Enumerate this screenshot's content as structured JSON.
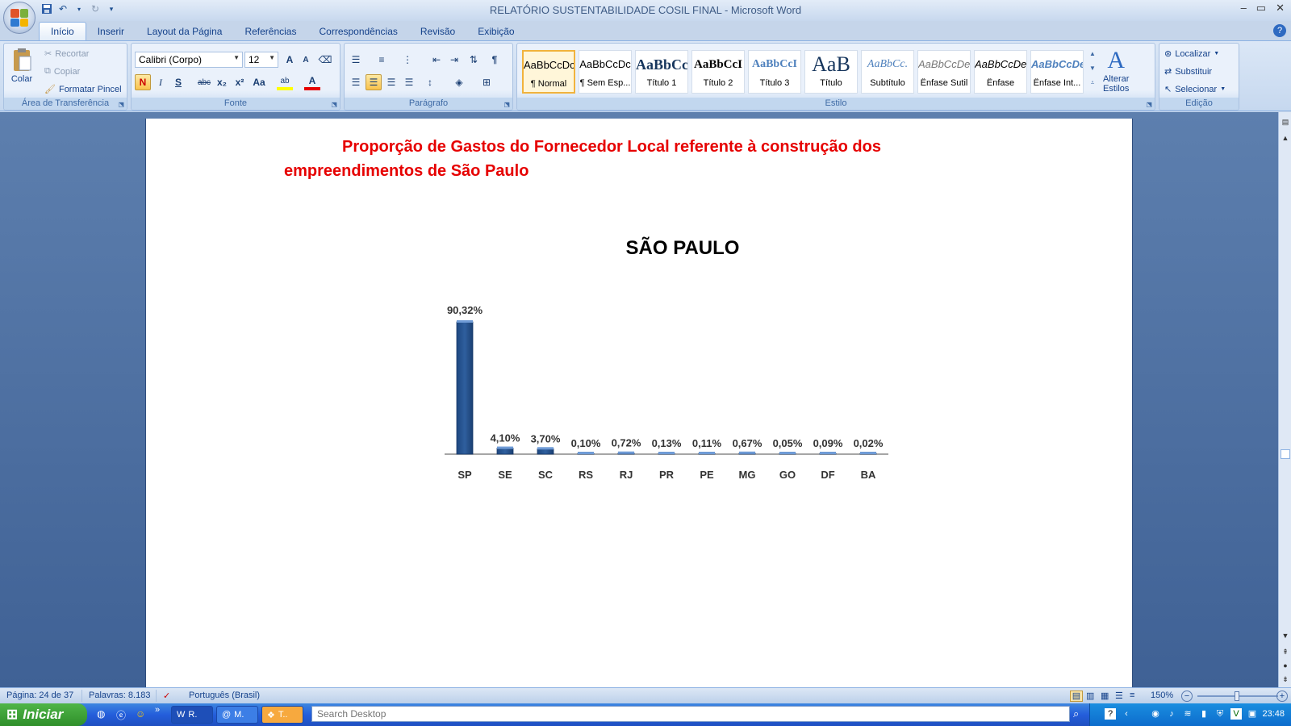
{
  "window": {
    "title": "RELATÓRIO SUSTENTABILIDADE COSIL FINAL - Microsoft Word",
    "controls": [
      "–",
      "▭",
      "✕"
    ]
  },
  "tabs": [
    {
      "label": "Início",
      "active": true
    },
    {
      "label": "Inserir"
    },
    {
      "label": "Layout da Página"
    },
    {
      "label": "Referências"
    },
    {
      "label": "Correspondências"
    },
    {
      "label": "Revisão"
    },
    {
      "label": "Exibição"
    }
  ],
  "ribbon": {
    "clipboard": {
      "label": "Área de Transferência",
      "paste": "Colar",
      "cut": "Recortar",
      "copy": "Copiar",
      "format_painter": "Formatar Pincel"
    },
    "font": {
      "label": "Fonte",
      "font_name": "Calibri (Corpo)",
      "font_size": "12",
      "bold": "N",
      "italic": "I",
      "underline": "S",
      "strike": "abc",
      "sub": "x₂",
      "sup": "x²",
      "case": "Aa",
      "grow": "A",
      "shrink": "A",
      "font_color": "A",
      "highlight": "ab"
    },
    "paragraph": {
      "label": "Parágrafo",
      "pilcrow": "¶"
    },
    "styles": {
      "label": "Estilo",
      "items": [
        {
          "sample": "AaBbCcDc",
          "name": "¶ Normal"
        },
        {
          "sample": "AaBbCcDc",
          "name": "¶ Sem Esp..."
        },
        {
          "sample": "AaBbCc",
          "name": "Título 1"
        },
        {
          "sample": "AaBbCcI",
          "name": "Título 2"
        },
        {
          "sample": "AaBbCcI",
          "name": "Título 3"
        },
        {
          "sample": "AaB",
          "name": "Título"
        },
        {
          "sample": "AaBbCc.",
          "name": "Subtítulo"
        },
        {
          "sample": "AaBbCcDe",
          "name": "Ênfase Sutil"
        },
        {
          "sample": "AaBbCcDe",
          "name": "Ênfase"
        },
        {
          "sample": "AaBbCcDe",
          "name": "Ênfase Int..."
        }
      ],
      "change_styles": "Alterar",
      "change_styles_2": "Estilos"
    },
    "editing": {
      "label": "Edição",
      "find": "Localizar",
      "replace": "Substituir",
      "select": "Selecionar"
    }
  },
  "document": {
    "heading_line1": "Proporção de Gastos do Fornecedor Local referente à construção dos",
    "heading_line2": "empreendimentos de São Paulo"
  },
  "chart_data": {
    "type": "bar",
    "title": "SÃO PAULO",
    "categories": [
      "SP",
      "SE",
      "SC",
      "RS",
      "RJ",
      "PR",
      "PE",
      "MG",
      "GO",
      "DF",
      "BA"
    ],
    "values": [
      90.32,
      4.1,
      3.7,
      0.1,
      0.72,
      0.13,
      0.11,
      0.67,
      0.05,
      0.09,
      0.02
    ],
    "data_labels": [
      "90,32%",
      "4,10%",
      "3,70%",
      "0,10%",
      "0,72%",
      "0,13%",
      "0,11%",
      "0,67%",
      "0,05%",
      "0,09%",
      "0,02%"
    ],
    "xlabel": "",
    "ylabel": "",
    "ylim": [
      0,
      90.32
    ],
    "grid": false,
    "legend": "none",
    "bar_color": "#2f5f9e"
  },
  "statusbar": {
    "page": "Página: 24 de 37",
    "words": "Palavras: 8.183",
    "language": "Português (Brasil)",
    "zoom": "150%"
  },
  "taskbar": {
    "start": "Iniciar",
    "tasks": [
      "R.",
      "M.",
      "T.."
    ],
    "search_placeholder": "Search Desktop",
    "clock": "23:48"
  }
}
